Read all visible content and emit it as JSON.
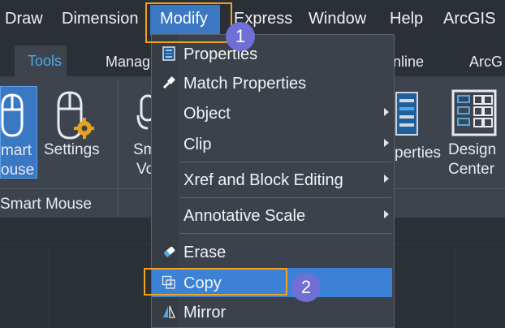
{
  "menubar": {
    "items": [
      "Draw",
      "Dimension",
      "Modify",
      "Express",
      "Window",
      "Help",
      "ArcGIS"
    ]
  },
  "ribbon_tabs": [
    "Tools",
    "Manag",
    "nline",
    "ArcG"
  ],
  "ribbon": {
    "smart_mouse_label_line1": "mart",
    "smart_mouse_label_line2": "ouse",
    "settings_label": "Settings",
    "smart_voice_line1": "Sm",
    "smart_voice_line2": "Vo",
    "properties_label": "perties",
    "design_center_line1": "Design",
    "design_center_line2": "Center",
    "panel_title": "Smart Mouse"
  },
  "dropdown": {
    "items": [
      {
        "label": "Properties",
        "icon": "properties-icon",
        "submenu": false
      },
      {
        "label": "Match Properties",
        "icon": "match-properties-icon",
        "submenu": false
      },
      {
        "label": "Object",
        "icon": "",
        "submenu": true
      },
      {
        "label": "Clip",
        "icon": "",
        "submenu": true
      },
      {
        "label": "Xref and Block Editing",
        "icon": "",
        "submenu": true
      },
      {
        "label": "Annotative Scale",
        "icon": "",
        "submenu": true
      },
      {
        "label": "Erase",
        "icon": "eraser-icon",
        "submenu": false
      },
      {
        "label": "Copy",
        "icon": "copy-icon",
        "submenu": false
      },
      {
        "label": "Mirror",
        "icon": "mirror-icon",
        "submenu": false
      }
    ]
  },
  "callouts": [
    "1",
    "2"
  ],
  "colors": {
    "accent": "#3b78c4",
    "highlight_box": "#f0a31e",
    "badge": "#6f6fd6",
    "menu_bg": "#3c424b",
    "selection": "#3b82d6"
  }
}
